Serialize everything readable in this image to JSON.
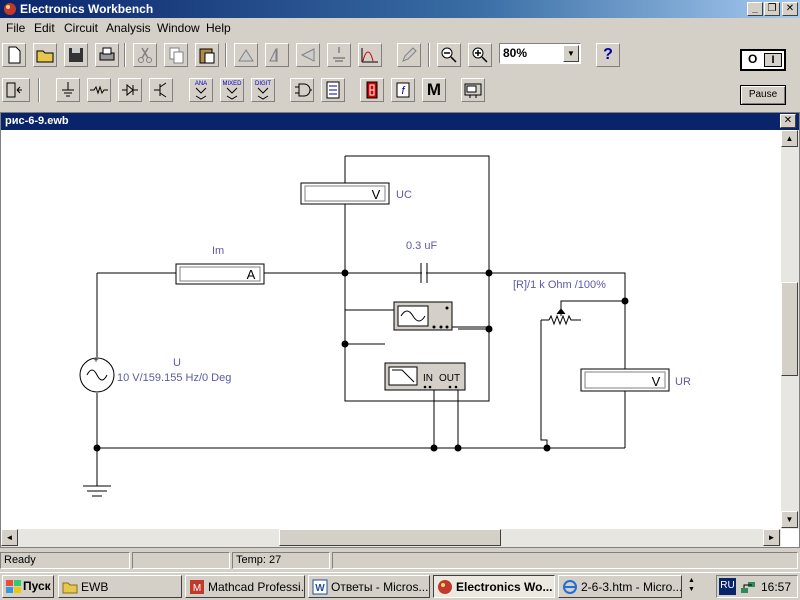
{
  "window": {
    "title": "Electronics Workbench",
    "minimize": "_",
    "maximize": "❐",
    "close": "✕"
  },
  "menu": [
    "File",
    "Edit",
    "Circuit",
    "Analysis",
    "Window",
    "Help"
  ],
  "toolbar": {
    "zoom": "80%",
    "help_label": "?",
    "parts": {
      "analog": "ANA",
      "mixed": "MIXED",
      "digital": "DIGIT",
      "misc": "M"
    },
    "pause_label": "Pause",
    "power_on": "I",
    "power_off": "O"
  },
  "document": {
    "title": "рис-6-9.ewb",
    "close": "✕"
  },
  "circuit": {
    "source_label": "U",
    "source_value": "10 V/159.155 Hz/0 Deg",
    "ammeter_label": "Im",
    "ammeter_unit": "A",
    "voltmeter_c_label": "UC",
    "voltmeter_c_unit": "V",
    "voltmeter_r_label": "UR",
    "voltmeter_r_unit": "V",
    "capacitor_value": "0.3 uF",
    "potentiometer_value": "[R]/1 k Ohm /100%",
    "plotter_in": "IN",
    "plotter_out": "OUT"
  },
  "status": {
    "text": "Ready",
    "temp": "Temp:  27"
  },
  "taskbar": {
    "start": "Пуск",
    "tasks": [
      {
        "label": "EWB",
        "active": false
      },
      {
        "label": "Mathcad Professi...",
        "active": false
      },
      {
        "label": "Ответы - Micros...",
        "active": false
      },
      {
        "label": "Electronics Wo...",
        "active": true
      },
      {
        "label": "2-6-3.htm - Micro...",
        "active": false
      }
    ],
    "lang": "RU",
    "time": "16:57"
  },
  "colors": {
    "wire": "#000000",
    "label": "#5a5aa8",
    "titlebar": "#0a246a"
  }
}
